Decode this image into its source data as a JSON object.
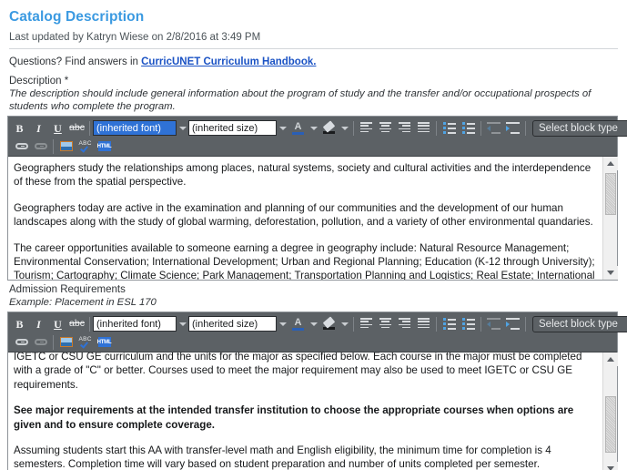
{
  "header": {
    "title": "Catalog Description",
    "last_updated": "Last updated by Katryn Wiese on 2/8/2016 at 3:49 PM",
    "questions_prefix": "Questions? Find answers in ",
    "questions_link": "CurricUNET Curriculum Handbook."
  },
  "colors": {
    "title": "#3b9ae1",
    "link": "#1a52c4",
    "toolbar_bg": "#5c6165",
    "selection": "#2f72d6"
  },
  "description": {
    "label": "Description *",
    "hint": "The description should include general information about the program of study and the transfer and/or occupational prospects of students who complete the program.",
    "paragraphs": [
      "Geographers study the relationships among places, natural systems, society and cultural activities and the interdependence of these from the spatial perspective.",
      "Geographers today are active in the examination and planning of our communities and the development of our human landscapes along with the study of global warming, deforestation, pollution, and a variety of other environmental quandaries.",
      "The career opportunities available to someone earning a degree in geography include: Natural Resource Management; Environmental Conservation; International Development; Urban and Regional Planning; Education (K-12 through University); Tourism; Cartography; Climate Science; Park Management; Transportation Planning and Logistics; Real Estate; International"
    ]
  },
  "admission": {
    "label": "Admission Requirements",
    "hint": "Example: Placement in ESL 170",
    "paragraphs": [
      "IGETC or CSU GE curriculum and the units for the major as specified below. Each course in the major must be completed with a grade of \"C\" or better. Courses used to meet the major requirement may also be used to meet IGETC or CSU GE requirements.",
      "See major requirements at the intended transfer institution to choose the appropriate courses when options are given and to ensure complete coverage.",
      "Assuming students start this AA with transfer-level math and English eligibility, the minimum time for completion is 4 semesters. Completion time will vary based on student preparation and number of units completed per semester."
    ]
  },
  "toolbar": {
    "bold": "B",
    "italic": "I",
    "underline": "U",
    "strikethrough": "abc",
    "font_value": "(inherited font)",
    "size_value": "(inherited size)",
    "block_type": "Select block type",
    "html_label": "HTML",
    "spell_label": "ABC"
  }
}
